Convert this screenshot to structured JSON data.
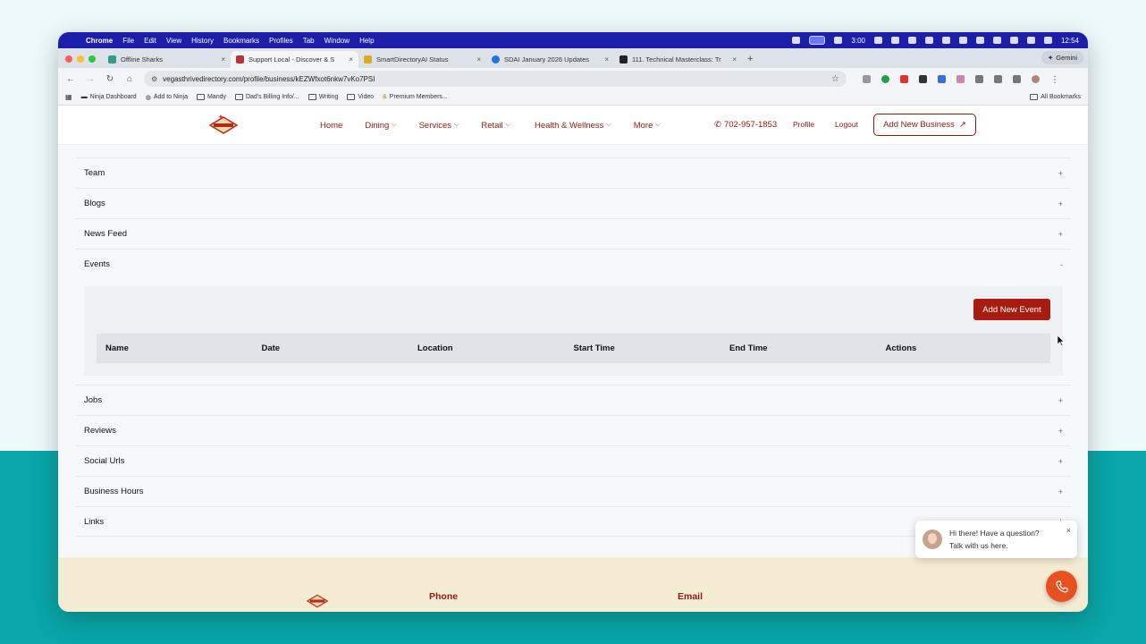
{
  "menubar": {
    "app": "Chrome",
    "items": [
      "File",
      "Edit",
      "View",
      "History",
      "Bookmarks",
      "Profiles",
      "Tab",
      "Window",
      "Help"
    ],
    "timer": "3:00",
    "clock": "12:54"
  },
  "tabs": [
    {
      "title": "Offline Sharks",
      "color": "#2f9e8f"
    },
    {
      "title": "Support Local - Discover & S",
      "color": "#b33",
      "active": true
    },
    {
      "title": "SmartDirectoryAI Status",
      "color": "#e0a91b"
    },
    {
      "title": "SDAI January 2026 Updates",
      "color": "#1a73e8"
    },
    {
      "title": "111. Technical Masterclass: Tr",
      "color": "#222"
    }
  ],
  "gemini_label": "Gemini",
  "address": {
    "url": "vegasthrivedirectory.com/profile/business/kEZWfxot6nkw7vKo7PSI"
  },
  "bookmarks": {
    "items": [
      "Ninja Dashboard",
      "Add to Ninja",
      "Mandy",
      "Dad's Billing Info/...",
      "Writing",
      "Video",
      "Premium Members..."
    ],
    "right": "All Bookmarks"
  },
  "site": {
    "nav": [
      {
        "label": "Home",
        "dropdown": false
      },
      {
        "label": "Dining",
        "dropdown": true
      },
      {
        "label": "Services",
        "dropdown": true
      },
      {
        "label": "Retail",
        "dropdown": true
      },
      {
        "label": "Health & Wellness",
        "dropdown": true
      },
      {
        "label": "More",
        "dropdown": true
      }
    ],
    "phone": "702-957-1853",
    "profile": "Profile",
    "logout": "Logout",
    "add_business": "Add New Business",
    "brand_color": "#8b1a10"
  },
  "accordion": {
    "top": [
      {
        "label": "Team",
        "sign": "+"
      },
      {
        "label": "Blogs",
        "sign": "+"
      },
      {
        "label": "News Feed",
        "sign": "+"
      },
      {
        "label": "Events",
        "sign": "-"
      }
    ],
    "events": {
      "add_button": "Add New Event",
      "columns": [
        "Name",
        "Date",
        "Location",
        "Start Time",
        "End Time",
        "Actions"
      ]
    },
    "bottom": [
      {
        "label": "Jobs",
        "sign": "+"
      },
      {
        "label": "Reviews",
        "sign": "+"
      },
      {
        "label": "Social Urls",
        "sign": "+"
      },
      {
        "label": "Business Hours",
        "sign": "+"
      },
      {
        "label": "Links",
        "sign": "+"
      }
    ]
  },
  "footer": {
    "phone_heading": "Phone",
    "email_heading": "Email"
  },
  "chat": {
    "line1": "Hi there! Have a question?",
    "line2": "Talk with us here.",
    "close": "×"
  }
}
